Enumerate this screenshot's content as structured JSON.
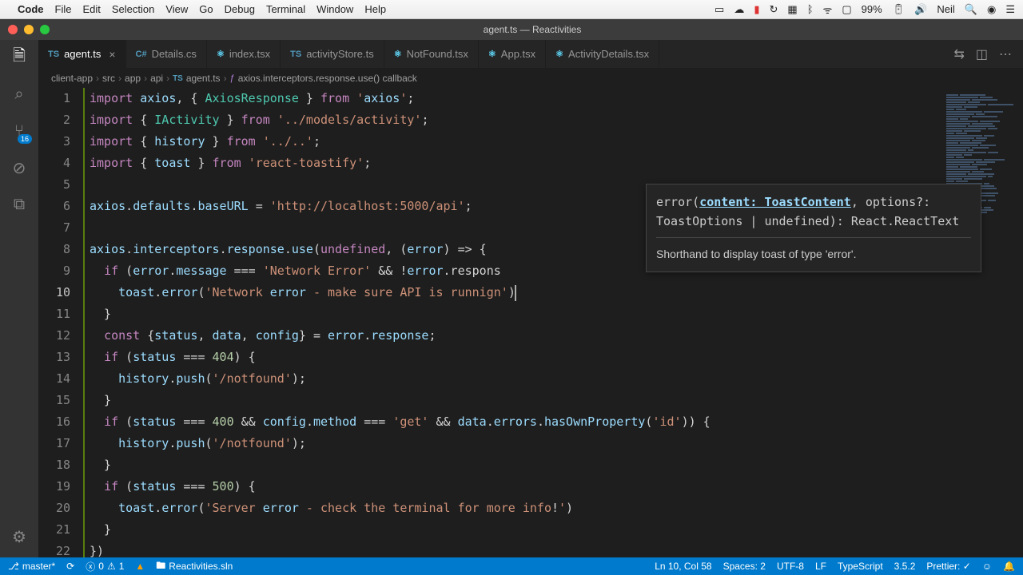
{
  "menubar": {
    "app": "Code",
    "items": [
      "File",
      "Edit",
      "Selection",
      "View",
      "Go",
      "Debug",
      "Terminal",
      "Window",
      "Help"
    ],
    "battery": "99%",
    "user": "Neil"
  },
  "window": {
    "title": "agent.ts — Reactivities"
  },
  "tabs": [
    {
      "label": "agent.ts",
      "icon": "TS",
      "active": true,
      "dirty": false
    },
    {
      "label": "Details.cs",
      "icon": "C#",
      "active": false
    },
    {
      "label": "index.tsx",
      "icon": "⚛",
      "active": false
    },
    {
      "label": "activityStore.ts",
      "icon": "TS",
      "active": false
    },
    {
      "label": "NotFound.tsx",
      "icon": "⚛",
      "active": false
    },
    {
      "label": "App.tsx",
      "icon": "⚛",
      "active": false
    },
    {
      "label": "ActivityDetails.tsx",
      "icon": "⚛",
      "active": false
    }
  ],
  "breadcrumbs": [
    "client-app",
    "src",
    "app",
    "api",
    "agent.ts",
    "axios.interceptors.response.use() callback"
  ],
  "scm_badge": "16",
  "code": {
    "lines": [
      {
        "n": 1,
        "t": "import axios, { AxiosResponse } from 'axios';"
      },
      {
        "n": 2,
        "t": "import { IActivity } from '../models/activity';"
      },
      {
        "n": 3,
        "t": "import { history } from '../..';"
      },
      {
        "n": 4,
        "t": "import { toast } from 'react-toastify';"
      },
      {
        "n": 5,
        "t": ""
      },
      {
        "n": 6,
        "t": "axios.defaults.baseURL = 'http://localhost:5000/api';"
      },
      {
        "n": 7,
        "t": ""
      },
      {
        "n": 8,
        "t": "axios.interceptors.response.use(undefined, (error) => {"
      },
      {
        "n": 9,
        "t": "  if (error.message === 'Network Error' && !error.respons"
      },
      {
        "n": 10,
        "t": "    toast.error('Network error - make sure API is runnign')"
      },
      {
        "n": 11,
        "t": "  }"
      },
      {
        "n": 12,
        "t": "  const {status, data, config} = error.response;"
      },
      {
        "n": 13,
        "t": "  if (status === 404) {"
      },
      {
        "n": 14,
        "t": "    history.push('/notfound');"
      },
      {
        "n": 15,
        "t": "  }"
      },
      {
        "n": 16,
        "t": "  if (status === 400 && config.method === 'get' && data.errors.hasOwnProperty('id')) {"
      },
      {
        "n": 17,
        "t": "    history.push('/notfound');"
      },
      {
        "n": 18,
        "t": "  }"
      },
      {
        "n": 19,
        "t": "  if (status === 500) {"
      },
      {
        "n": 20,
        "t": "    toast.error('Server error - check the terminal for more info!')"
      },
      {
        "n": 21,
        "t": "  }"
      },
      {
        "n": 22,
        "t": "})"
      }
    ],
    "activeLine": 10
  },
  "sighelp": {
    "sig_pre": "error(",
    "param": "content: ToastContent",
    "sig_post": ", options?: ToastOptions | undefined): React.ReactText",
    "desc": "Shorthand to display toast of type 'error'."
  },
  "statusbar": {
    "branch": "master*",
    "errors": "0",
    "warnings": "1",
    "solution": "Reactivities.sln",
    "cursor": "Ln 10, Col 58",
    "spaces": "Spaces: 2",
    "encoding": "UTF-8",
    "eol": "LF",
    "lang": "TypeScript",
    "tsver": "3.5.2",
    "prettier": "Prettier: ✓"
  }
}
